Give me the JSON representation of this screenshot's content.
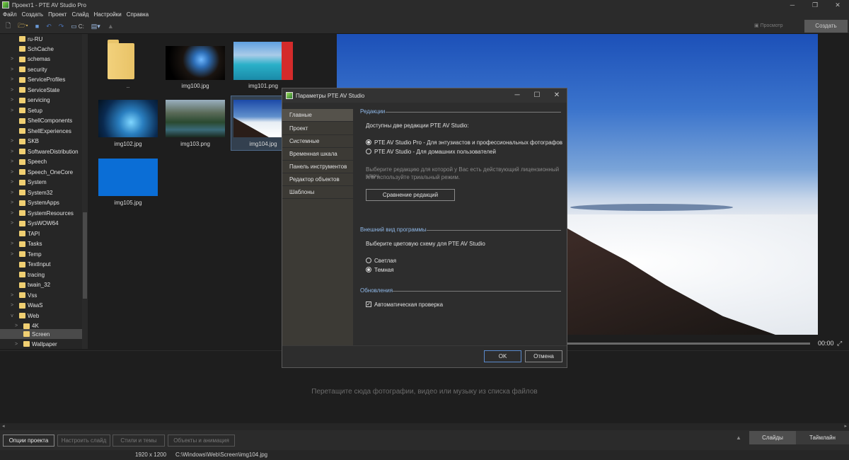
{
  "window": {
    "title": "Проект1 - PTE AV Studio Pro",
    "min": "─",
    "max": "❐",
    "close": "✕"
  },
  "menu": [
    "Файл",
    "Создать",
    "Проект",
    "Слайд",
    "Настройки",
    "Справка"
  ],
  "toolbar": {
    "drive": "C:",
    "preview_label": "Просмотр",
    "create_label": "Создать"
  },
  "tree": [
    {
      "label": "ru-RU",
      "arrow": ""
    },
    {
      "label": "SchCache",
      "arrow": ""
    },
    {
      "label": "schemas",
      "arrow": ">"
    },
    {
      "label": "security",
      "arrow": ">"
    },
    {
      "label": "ServiceProfiles",
      "arrow": ">"
    },
    {
      "label": "ServiceState",
      "arrow": ">"
    },
    {
      "label": "servicing",
      "arrow": ">"
    },
    {
      "label": "Setup",
      "arrow": ">"
    },
    {
      "label": "ShellComponents",
      "arrow": ""
    },
    {
      "label": "ShellExperiences",
      "arrow": ""
    },
    {
      "label": "SKB",
      "arrow": ">"
    },
    {
      "label": "SoftwareDistribution",
      "arrow": ">"
    },
    {
      "label": "Speech",
      "arrow": ">"
    },
    {
      "label": "Speech_OneCore",
      "arrow": ">"
    },
    {
      "label": "System",
      "arrow": ">"
    },
    {
      "label": "System32",
      "arrow": ">"
    },
    {
      "label": "SystemApps",
      "arrow": ">"
    },
    {
      "label": "SystemResources",
      "arrow": ">"
    },
    {
      "label": "SysWOW64",
      "arrow": ">"
    },
    {
      "label": "TAPI",
      "arrow": ""
    },
    {
      "label": "Tasks",
      "arrow": ">"
    },
    {
      "label": "Temp",
      "arrow": ">"
    },
    {
      "label": "TextInput",
      "arrow": ""
    },
    {
      "label": "tracing",
      "arrow": ""
    },
    {
      "label": "twain_32",
      "arrow": ""
    },
    {
      "label": "Vss",
      "arrow": ">"
    },
    {
      "label": "WaaS",
      "arrow": ">"
    },
    {
      "label": "Web",
      "arrow": "v"
    },
    {
      "label": "4K",
      "arrow": ">"
    },
    {
      "label": "Screen",
      "arrow": ""
    },
    {
      "label": "Wallpaper",
      "arrow": ">"
    }
  ],
  "files": [
    {
      "name": "..",
      "kind": "folder"
    },
    {
      "name": "img100.jpg",
      "kind": "image"
    },
    {
      "name": "img101.png",
      "kind": "image"
    },
    {
      "name": "img102.jpg",
      "kind": "image"
    },
    {
      "name": "img103.png",
      "kind": "image"
    },
    {
      "name": "img104.jpg",
      "kind": "image"
    },
    {
      "name": "img105.jpg",
      "kind": "image"
    }
  ],
  "player": {
    "time": "00:00"
  },
  "slides": {
    "drop_hint": "Перетащите сюда фотографии, видео или музыку из списка файлов"
  },
  "bottom": {
    "project_options": "Опции проекта",
    "customize_slide": "Настроить слайд",
    "styles_themes": "Стили и темы",
    "objects_animation": "Объекты и анимация",
    "tab_slides": "Слайды",
    "tab_timeline": "Таймлайн"
  },
  "status": {
    "resolution": "1920 x 1200",
    "path": "C:\\Windows\\Web\\Screen\\img104.jpg"
  },
  "dialog": {
    "title": "Параметры PTE AV Studio",
    "nav": [
      "Главные",
      "Проект",
      "Системные",
      "Временная шкала",
      "Панель инструментов",
      "Редактор объектов",
      "Шаблоны"
    ],
    "section_editions": "Редакции",
    "editions_intro": "Доступны две редакции PTE AV Studio:",
    "edition_pro": "PTE AV Studio Pro - Для энтузиастов и профессиональных фотографов",
    "edition_home": "PTE AV Studio - Для домашних пользователей",
    "license_hint_1": "Выберите редакцию для которой у Вас есть действующий лицензионный ключ",
    "license_hint_2": "или используйте триальный режим.",
    "compare_button": "Сравнение редакций",
    "section_appearance": "Внешний вид программы",
    "appearance_intro": "Выберите цветовую схему для PTE AV Studio",
    "theme_light": "Светлая",
    "theme_dark": "Темная",
    "section_updates": "Обновления",
    "auto_check": "Автоматическая проверка",
    "ok": "OK",
    "cancel": "Отмена"
  }
}
